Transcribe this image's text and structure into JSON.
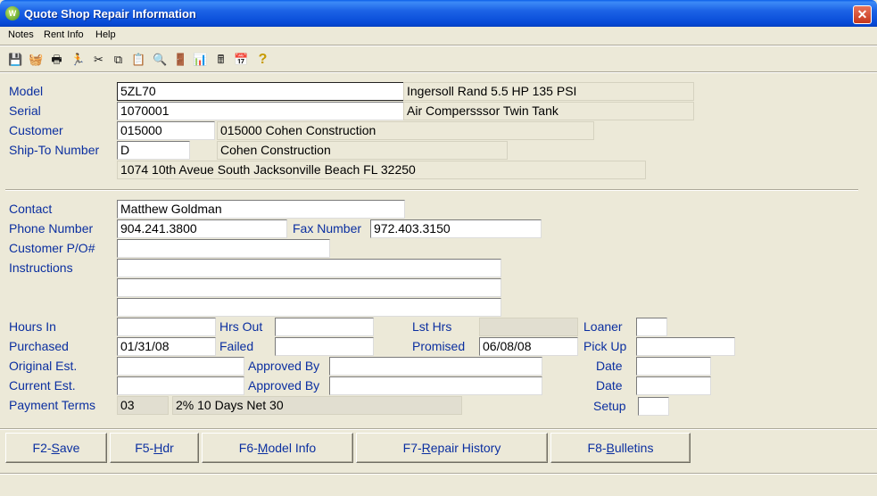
{
  "window": {
    "title": "Quote Shop Repair Information",
    "close_glyph": "✕",
    "app_icon": "app-logo-icon"
  },
  "menu": {
    "items": [
      "Notes",
      "Rent Info",
      "Help"
    ]
  },
  "toolbar": {
    "buttons": [
      {
        "name": "save-icon",
        "glyph": "💾"
      },
      {
        "name": "basket-icon",
        "glyph": "🧺"
      },
      {
        "name": "print-icon",
        "glyph": "🖶"
      },
      {
        "name": "runner-icon",
        "glyph": "🏃"
      },
      {
        "name": "cut-icon",
        "glyph": "✂"
      },
      {
        "name": "copy-icon",
        "glyph": "⧉"
      },
      {
        "name": "paste-icon",
        "glyph": "📋"
      },
      {
        "name": "find-icon",
        "glyph": "🔍"
      },
      {
        "name": "exit-door-icon",
        "glyph": "🚪"
      },
      {
        "name": "chart-icon",
        "glyph": "📊"
      },
      {
        "name": "calculator-icon",
        "glyph": "🖩"
      },
      {
        "name": "calendar-icon",
        "glyph": "📅"
      },
      {
        "name": "help-icon",
        "glyph": "?"
      }
    ]
  },
  "header": {
    "model": {
      "label": "Model",
      "value": "5ZL70",
      "description": "Ingersoll Rand 5.5 HP 135 PSI"
    },
    "serial": {
      "label": "Serial",
      "value": "1070001",
      "description": "Air Compersssor Twin Tank"
    },
    "customer": {
      "label": "Customer",
      "value": "015000",
      "description": "015000 Cohen Construction"
    },
    "ship_to": {
      "label": "Ship-To Number",
      "value": "D",
      "description": "Cohen Construction"
    },
    "address": "1074 10th Aveue South Jacksonville Beach FL 32250"
  },
  "contact": {
    "contact": {
      "label": "Contact",
      "value": "Matthew Goldman"
    },
    "phone": {
      "label": "Phone Number",
      "value": "904.241.3800"
    },
    "fax": {
      "label": "Fax Number",
      "value": "972.403.3150"
    },
    "po": {
      "label": "Customer P/O#",
      "value": ""
    },
    "instructions": {
      "label": "Instructions",
      "lines": [
        "",
        "",
        ""
      ]
    }
  },
  "dates": {
    "hours_in": {
      "label": "Hours In",
      "value": ""
    },
    "hrs_out": {
      "label": "Hrs Out",
      "value": ""
    },
    "lst_hrs": {
      "label": "Lst Hrs",
      "value": ""
    },
    "loaner": {
      "label": "Loaner",
      "value": ""
    },
    "purchased": {
      "label": "Purchased",
      "value": "01/31/08"
    },
    "failed": {
      "label": "Failed",
      "value": ""
    },
    "promised": {
      "label": "Promised",
      "value": "06/08/08"
    },
    "pick_up": {
      "label": "Pick Up",
      "value": ""
    },
    "original_est": {
      "label": "Original Est.",
      "value": ""
    },
    "approved_by_1": {
      "label": "Approved By",
      "value": ""
    },
    "date_1": {
      "label": "Date",
      "value": ""
    },
    "current_est": {
      "label": "Current Est.",
      "value": ""
    },
    "approved_by_2": {
      "label": "Approved By",
      "value": ""
    },
    "date_2": {
      "label": "Date",
      "value": ""
    },
    "payment_terms": {
      "label": "Payment Terms",
      "code": "03",
      "description": "2% 10 Days Net 30"
    },
    "setup": {
      "label": "Setup",
      "value": ""
    }
  },
  "actions": {
    "save": {
      "prefix": "F2-",
      "key": "S",
      "rest": "ave"
    },
    "hdr": {
      "prefix": "F5-",
      "key": "H",
      "rest": "dr"
    },
    "model_info": {
      "prefix": "F6-",
      "key": "M",
      "rest": "odel Info"
    },
    "repair_history": {
      "prefix": "F7-",
      "key": "R",
      "rest": "epair History"
    },
    "bulletins": {
      "prefix": "F8-",
      "key": "B",
      "rest": "ulletins"
    }
  },
  "colors": {
    "label_blue": "#0b2fa0",
    "face": "#ece9d8",
    "titlebar": "#0649d6"
  }
}
